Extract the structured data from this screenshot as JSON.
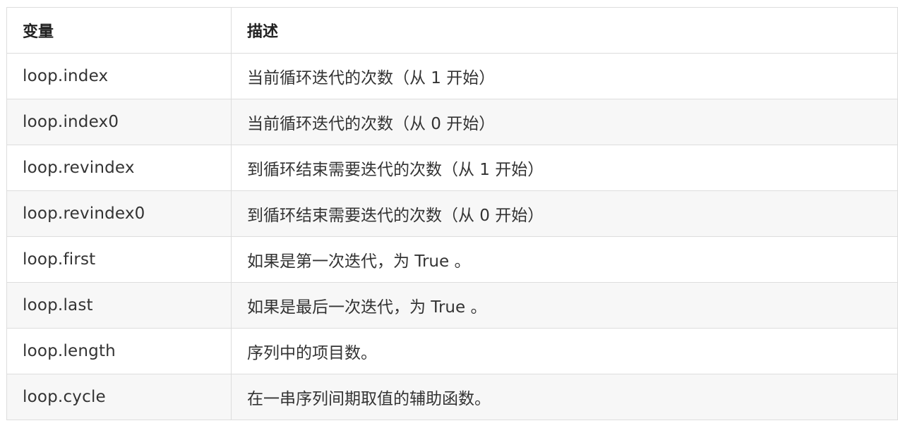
{
  "table": {
    "headers": [
      "变量",
      "描述"
    ],
    "rows": [
      [
        "loop.index",
        "当前循环迭代的次数（从 1 开始）"
      ],
      [
        "loop.index0",
        "当前循环迭代的次数（从 0 开始）"
      ],
      [
        "loop.revindex",
        "到循环结束需要迭代的次数（从 1 开始）"
      ],
      [
        "loop.revindex0",
        "到循环结束需要迭代的次数（从 0 开始）"
      ],
      [
        "loop.first",
        "如果是第一次迭代，为 True 。"
      ],
      [
        "loop.last",
        "如果是最后一次迭代，为 True 。"
      ],
      [
        "loop.length",
        "序列中的项目数。"
      ],
      [
        "loop.cycle",
        "在一串序列间期取值的辅助函数。"
      ]
    ]
  },
  "colors": {
    "border": "#dddddd",
    "stripe": "#f7f7f7",
    "text": "#333333"
  }
}
